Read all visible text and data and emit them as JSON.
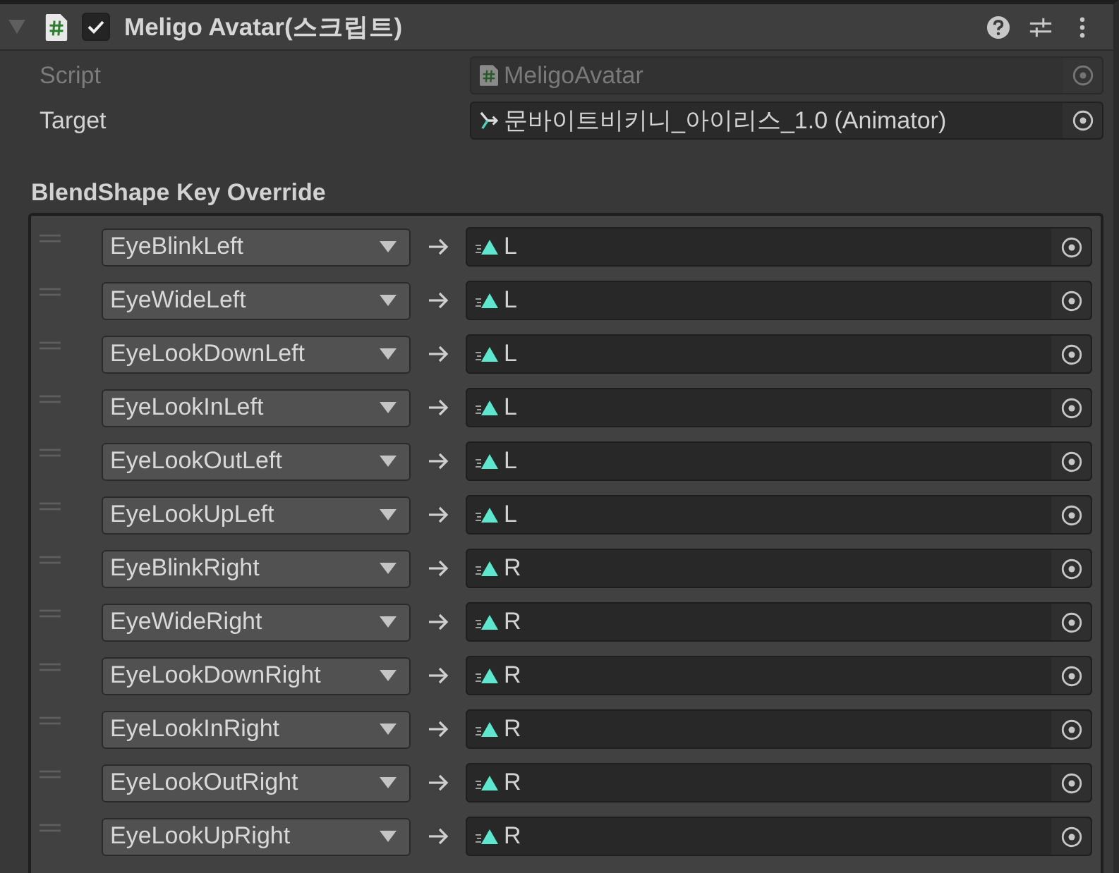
{
  "component": {
    "title": "Meligo Avatar(스크립트)",
    "expanded": true,
    "enabled": true
  },
  "fields": [
    {
      "kind": "script",
      "label": "Script",
      "value": "MeligoAvatar",
      "disabled": true
    },
    {
      "kind": "animator",
      "label": "Target",
      "value": "문바이트비키니_아이리스_1.0 (Animator)",
      "disabled": false
    }
  ],
  "list": {
    "title": "BlendShape Key Override",
    "rows": [
      {
        "key": "EyeBlinkLeft",
        "value": "L"
      },
      {
        "key": "EyeWideLeft",
        "value": "L"
      },
      {
        "key": "EyeLookDownLeft",
        "value": "L"
      },
      {
        "key": "EyeLookInLeft",
        "value": "L"
      },
      {
        "key": "EyeLookOutLeft",
        "value": "L"
      },
      {
        "key": "EyeLookUpLeft",
        "value": "L"
      },
      {
        "key": "EyeBlinkRight",
        "value": "R"
      },
      {
        "key": "EyeWideRight",
        "value": "R"
      },
      {
        "key": "EyeLookDownRight",
        "value": "R"
      },
      {
        "key": "EyeLookInRight",
        "value": "R"
      },
      {
        "key": "EyeLookOutRight",
        "value": "R"
      },
      {
        "key": "EyeLookUpRight",
        "value": "R"
      }
    ]
  }
}
